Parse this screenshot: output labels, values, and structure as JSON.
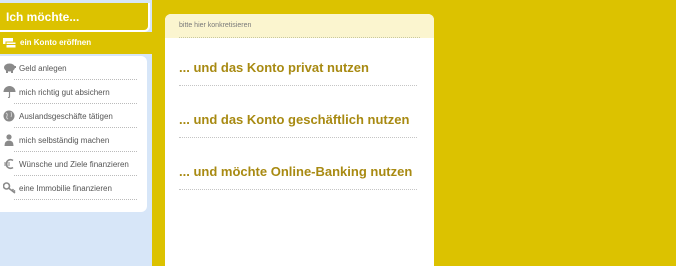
{
  "sidebar": {
    "header": "Ich möchte...",
    "active_item": {
      "label": "ein Konto eröffnen",
      "icon": "money-cards-icon"
    },
    "items": [
      {
        "label": "Geld anlegen",
        "icon": "piggy-bank-icon"
      },
      {
        "label": "mich richtig gut absichern",
        "icon": "umbrella-icon"
      },
      {
        "label": "Auslandsgeschäfte tätigen",
        "icon": "globe-icon"
      },
      {
        "label": "mich selbständig machen",
        "icon": "person-icon"
      },
      {
        "label": "Wünsche und Ziele finanzieren",
        "icon": "euro-icon"
      },
      {
        "label": "eine Immobilie finanzieren",
        "icon": "key-icon"
      }
    ]
  },
  "panel": {
    "hint": "bitte hier konkretisieren",
    "options": [
      {
        "label": "...  und das Konto privat nutzen"
      },
      {
        "label": "...  und das Konto geschäftlich nutzen"
      },
      {
        "label": "...  und möchte Online-Banking nutzen"
      }
    ]
  },
  "colors": {
    "background": "#dcc200",
    "accent_text": "#a88a12",
    "sidebar_bg": "#d7e6f8",
    "panel_header_bg": "#fbf5cf"
  }
}
